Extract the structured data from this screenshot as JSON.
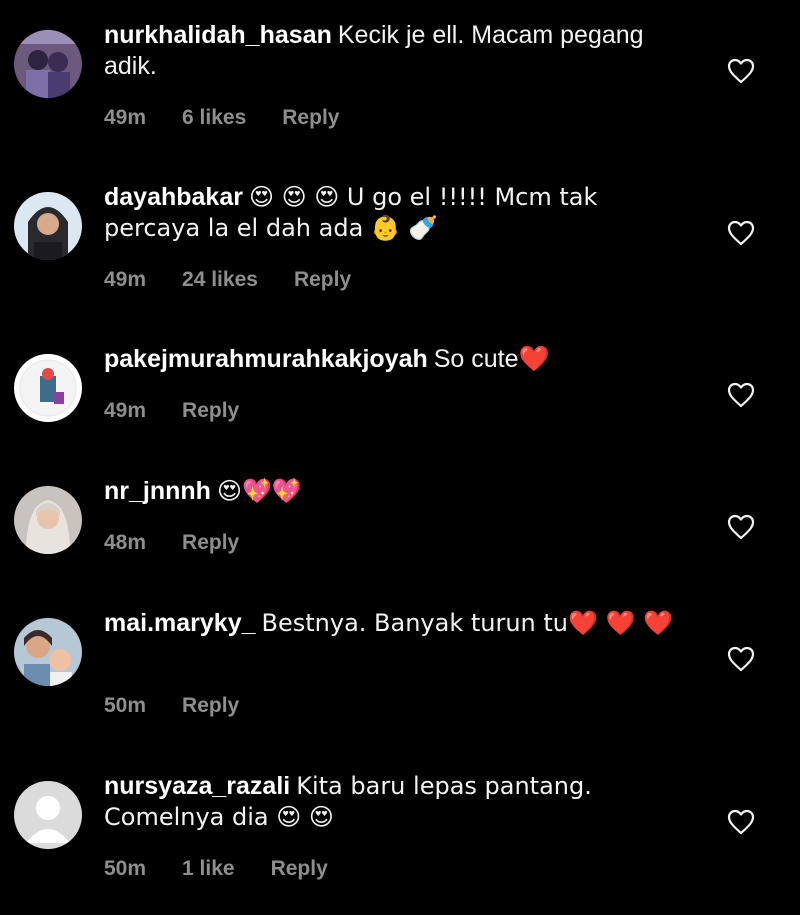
{
  "colors": {
    "background": "#000000",
    "text": "#f2f2f2",
    "meta": "#8e8e8e",
    "accent_heart": "#e0245e"
  },
  "comments": [
    {
      "username": "nurkhalidah_hasan",
      "text": "Kecik je ell. Macam pegang adik.",
      "time": "49m",
      "likes": "6 likes",
      "reply": "Reply",
      "emoji": ""
    },
    {
      "username": "dayahbakar",
      "text": "😍 😍 😍  U go el !!!!! Mcm tak percaya la el dah ada 👶 🍼",
      "time": "49m",
      "likes": "24 likes",
      "reply": "Reply",
      "emoji": ""
    },
    {
      "username": "pakejmurahmurahkakjoyah",
      "text": "So cute❤️",
      "time": "49m",
      "likes": "",
      "reply": "Reply",
      "emoji": ""
    },
    {
      "username": "nr_jnnnh",
      "text": "😍💖💖",
      "time": "48m",
      "likes": "",
      "reply": "Reply",
      "emoji": ""
    },
    {
      "username": "mai.maryky_",
      "text": "Bestnya. Banyak turun tu❤️ ❤️ ❤️",
      "time": "50m",
      "likes": "",
      "reply": "Reply",
      "emoji": ""
    },
    {
      "username": "nursyaza_razali",
      "text": "Kita baru lepas pantang. Comelnya dia 😍 😍",
      "time": "50m",
      "likes": "1 like",
      "reply": "Reply",
      "emoji": ""
    }
  ]
}
